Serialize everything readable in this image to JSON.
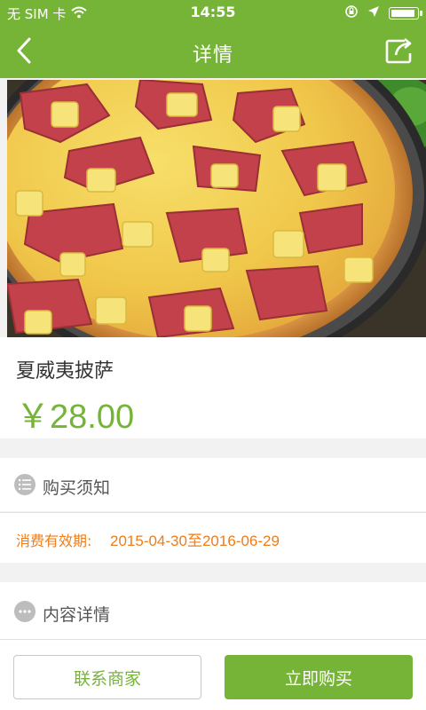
{
  "status": {
    "carrier": "无 SIM 卡",
    "time": "14:55",
    "battery_level": 0.92
  },
  "nav": {
    "title": "详情"
  },
  "product": {
    "name": "夏威夷披萨",
    "price": "￥28.00"
  },
  "sections": {
    "purchase_notice": "购买须知",
    "validity_label": "消费有效期:",
    "validity_value": "2015-04-30至2016-06-29",
    "content_detail": "内容详情"
  },
  "actions": {
    "contact": "联系商家",
    "buy": "立即购买"
  },
  "colors": {
    "brand": "#76b437",
    "accent_orange": "#ee7d1a"
  },
  "icons": {
    "back": "chevron-left-icon",
    "share": "share-icon",
    "notice": "list-icon",
    "detail": "more-dots-icon"
  }
}
